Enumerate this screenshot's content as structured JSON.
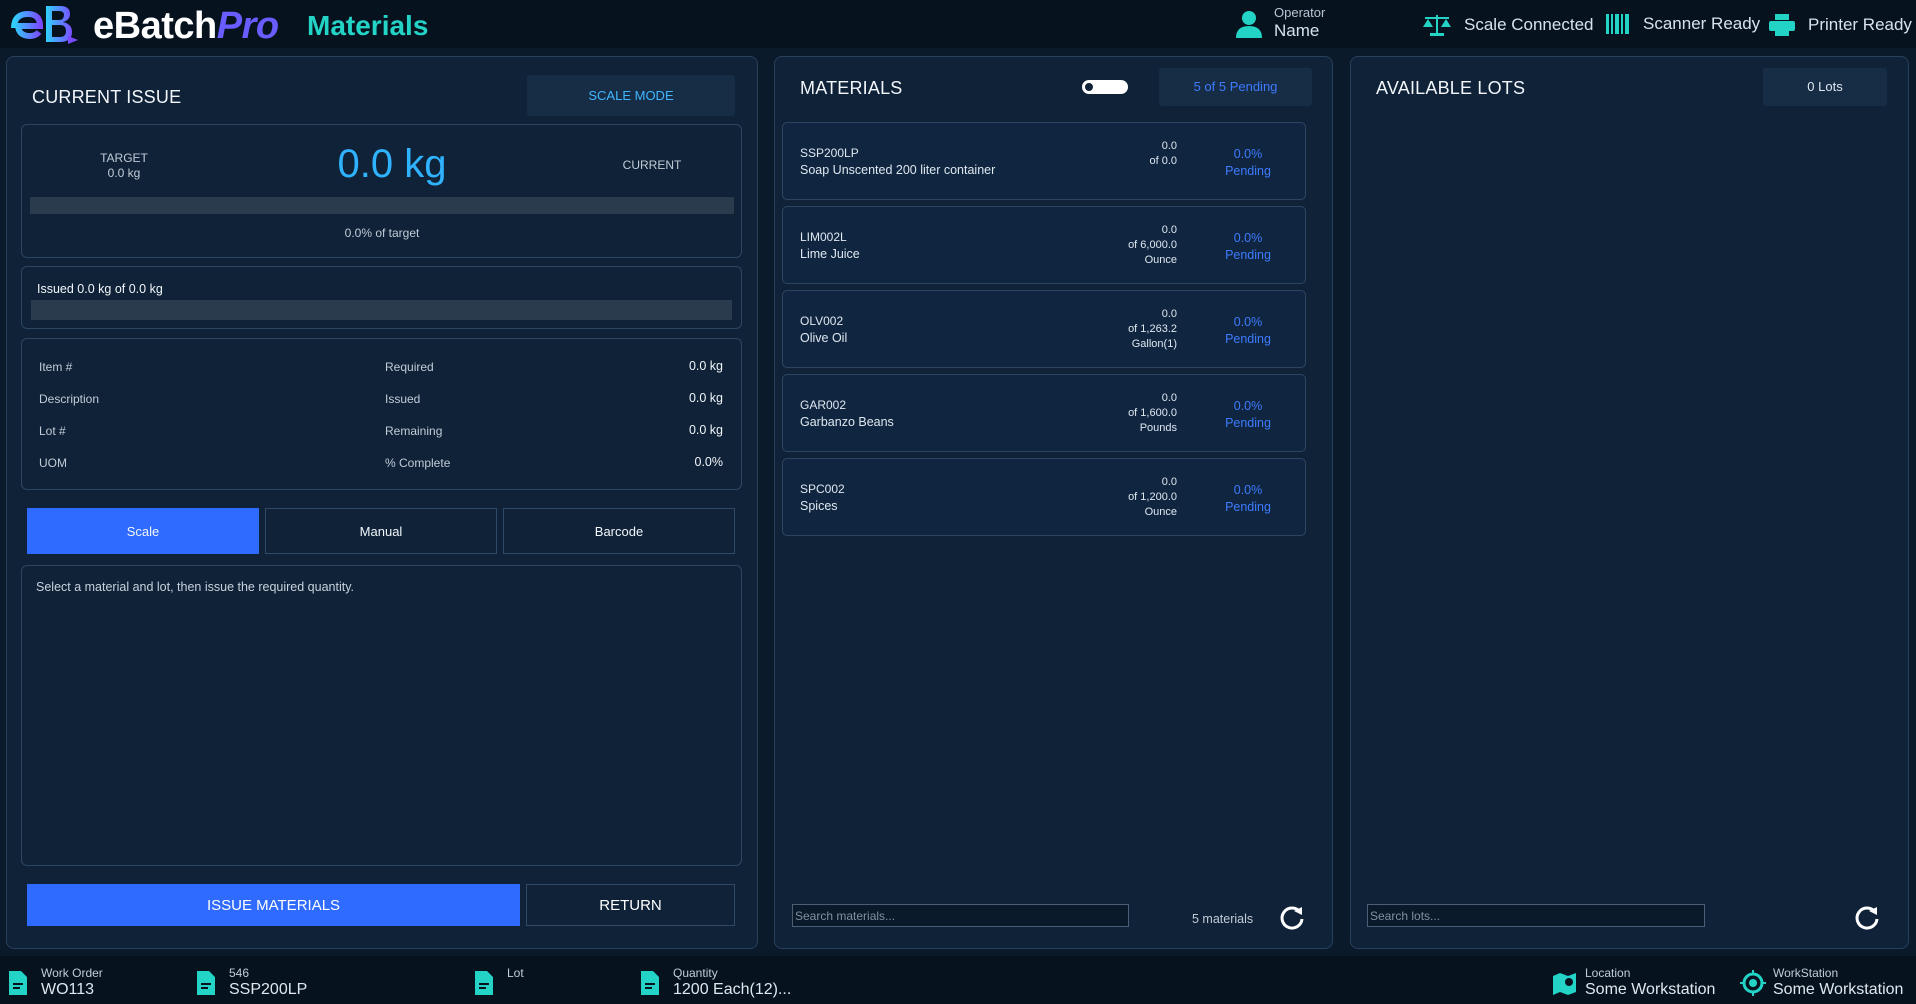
{
  "header": {
    "brand_main": "eBatch",
    "brand_pro": "Pro",
    "page_title": "Materials",
    "operator_label": "Operator",
    "operator_name": "Name",
    "status": {
      "scale": "Scale Connected",
      "scanner": "Scanner Ready",
      "printer": "Printer Ready"
    }
  },
  "current_issue": {
    "title": "CURRENT ISSUE",
    "mode_chip": "SCALE MODE",
    "target_label": "TARGET",
    "target_value": "0.0 kg",
    "weight": "0.0 kg",
    "current_label": "CURRENT",
    "target_progress": 0.0,
    "target_progress_text": "0.0% of target",
    "issued_text": "Issued 0.0 kg of 0.0 kg",
    "issued_progress": 0.0,
    "details": {
      "item_label": "Item #",
      "description_label": "Description",
      "lot_label": "Lot #",
      "uom_label": "UOM",
      "required_label": "Required",
      "required_value": "0.0 kg",
      "issued_label": "Issued",
      "issued_value": "0.0 kg",
      "remaining_label": "Remaining",
      "remaining_value": "0.0 kg",
      "complete_label": "% Complete",
      "complete_value": "0.0%"
    },
    "modes": [
      "Scale",
      "Manual",
      "Barcode"
    ],
    "active_mode": "Scale",
    "message": "Select a material and lot, then issue the required quantity.",
    "issue_button": "ISSUE MATERIALS",
    "return_button": "RETURN"
  },
  "materials": {
    "title": "MATERIALS",
    "pending_chip": "5 of 5 Pending",
    "items": [
      {
        "code": "SSP200LP",
        "description": "Soap Unscented 200 liter container",
        "issued": "0.0",
        "of": "of 0.0",
        "uom": "",
        "percent": "0.0%",
        "status": "Pending"
      },
      {
        "code": "LIM002L",
        "description": "Lime Juice",
        "issued": "0.0",
        "of": "of 6,000.0",
        "uom": "Ounce",
        "percent": "0.0%",
        "status": "Pending"
      },
      {
        "code": "OLV002",
        "description": "Olive Oil",
        "issued": "0.0",
        "of": "of 1,263.2",
        "uom": "Gallon(1)",
        "percent": "0.0%",
        "status": "Pending"
      },
      {
        "code": "GAR002",
        "description": "Garbanzo Beans",
        "issued": "0.0",
        "of": "of 1,600.0",
        "uom": "Pounds",
        "percent": "0.0%",
        "status": "Pending"
      },
      {
        "code": "SPC002",
        "description": "Spices",
        "issued": "0.0",
        "of": "of 1,200.0",
        "uom": "Ounce",
        "percent": "0.0%",
        "status": "Pending"
      }
    ],
    "search_placeholder": "Search materials...",
    "count_text": "5 materials"
  },
  "lots": {
    "title": "AVAILABLE LOTS",
    "count_chip": "0 Lots",
    "search_placeholder": "Search lots..."
  },
  "footer": {
    "work_order_label": "Work Order",
    "work_order_value": "WO113",
    "item_label": "546",
    "item_value": "SSP200LP",
    "lot_label": "Lot",
    "lot_value": "",
    "quantity_label": "Quantity",
    "quantity_value": "1200 Each(12)...",
    "location_label": "Location",
    "location_value": "Some Workstation",
    "workstation_label": "WorkStation",
    "workstation_value": "Some Workstation"
  },
  "colors": {
    "accent": "#2f6bff",
    "teal": "#23d3c6",
    "weight": "#2fb3ff",
    "pending": "#3d7bff"
  }
}
